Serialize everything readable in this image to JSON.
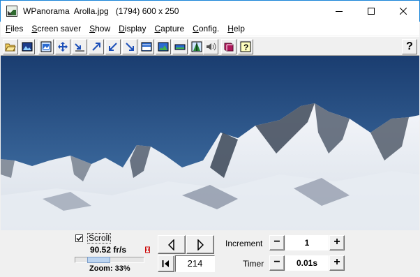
{
  "window": {
    "title": "WPanorama  Arolla.jpg   (1794) 600 x 250",
    "icon": "wpanorama-app-icon",
    "controls": [
      "minimize-icon",
      "maximize-icon",
      "close-icon"
    ]
  },
  "menu": {
    "items": [
      {
        "label": "Files",
        "accel": "F",
        "rest": "iles"
      },
      {
        "label": "Screen saver",
        "accel": "S",
        "rest": "creen saver"
      },
      {
        "label": "Show",
        "accel": "S",
        "rest": "how"
      },
      {
        "label": "Display",
        "accel": "D",
        "rest": "isplay"
      },
      {
        "label": "Capture",
        "accel": "C",
        "rest": "apture"
      },
      {
        "label": "Config.",
        "accel": "C",
        "rest": "onfig."
      },
      {
        "label": "Help",
        "accel": "H",
        "rest": "elp"
      }
    ]
  },
  "toolbar": {
    "icons": [
      "open-folder-icon",
      "image-icon",
      "fit-window-icon",
      "move-arrows-icon",
      "arrow-left-down-icon",
      "arrow-up-right-icon",
      "arrow-down-left-icon",
      "arrow-down-right-icon",
      "panorama-up-icon",
      "panorama-landscape-icon",
      "panorama-flat-icon",
      "vertical-view-icon",
      "sound-icon",
      "book-icon",
      "help-window-icon",
      "context-help-icon"
    ],
    "help_label": "?"
  },
  "panorama": {
    "file": "Arolla.jpg",
    "sky_top": "#1a3d70",
    "sky_bottom": "#3c6ca0"
  },
  "controls": {
    "scroll_label": "Scroll",
    "scroll_checked": true,
    "fps": "90.52 fr/s",
    "zoom_label": "Zoom: 33%",
    "zoom_percent": 33,
    "position": "214",
    "increment_label": "Increment",
    "increment_value": "1",
    "timer_label": "Timer",
    "timer_value": "0.01s",
    "minus": "−",
    "plus": "+"
  }
}
